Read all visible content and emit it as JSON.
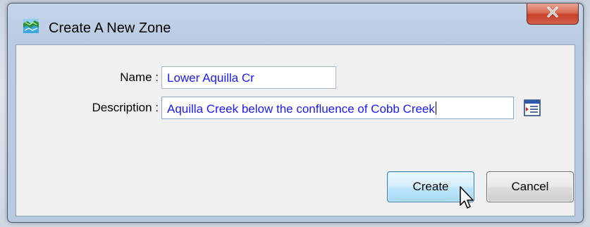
{
  "window": {
    "title": "Create A New Zone",
    "icon": "zone-map-icon",
    "close_icon": "close-x-icon"
  },
  "form": {
    "name_label": "Name :",
    "name_value": "Lower Aquilla Cr",
    "description_label": "Description :",
    "description_value": "Aquilla Creek below the confluence of Cobb Creek",
    "picker_icon": "text-editor-icon"
  },
  "buttons": {
    "create_label": "Create",
    "cancel_label": "Cancel"
  },
  "colors": {
    "field_text": "#1a1aff",
    "close_button": "#c6402a",
    "default_button": "#a7d9f5"
  }
}
